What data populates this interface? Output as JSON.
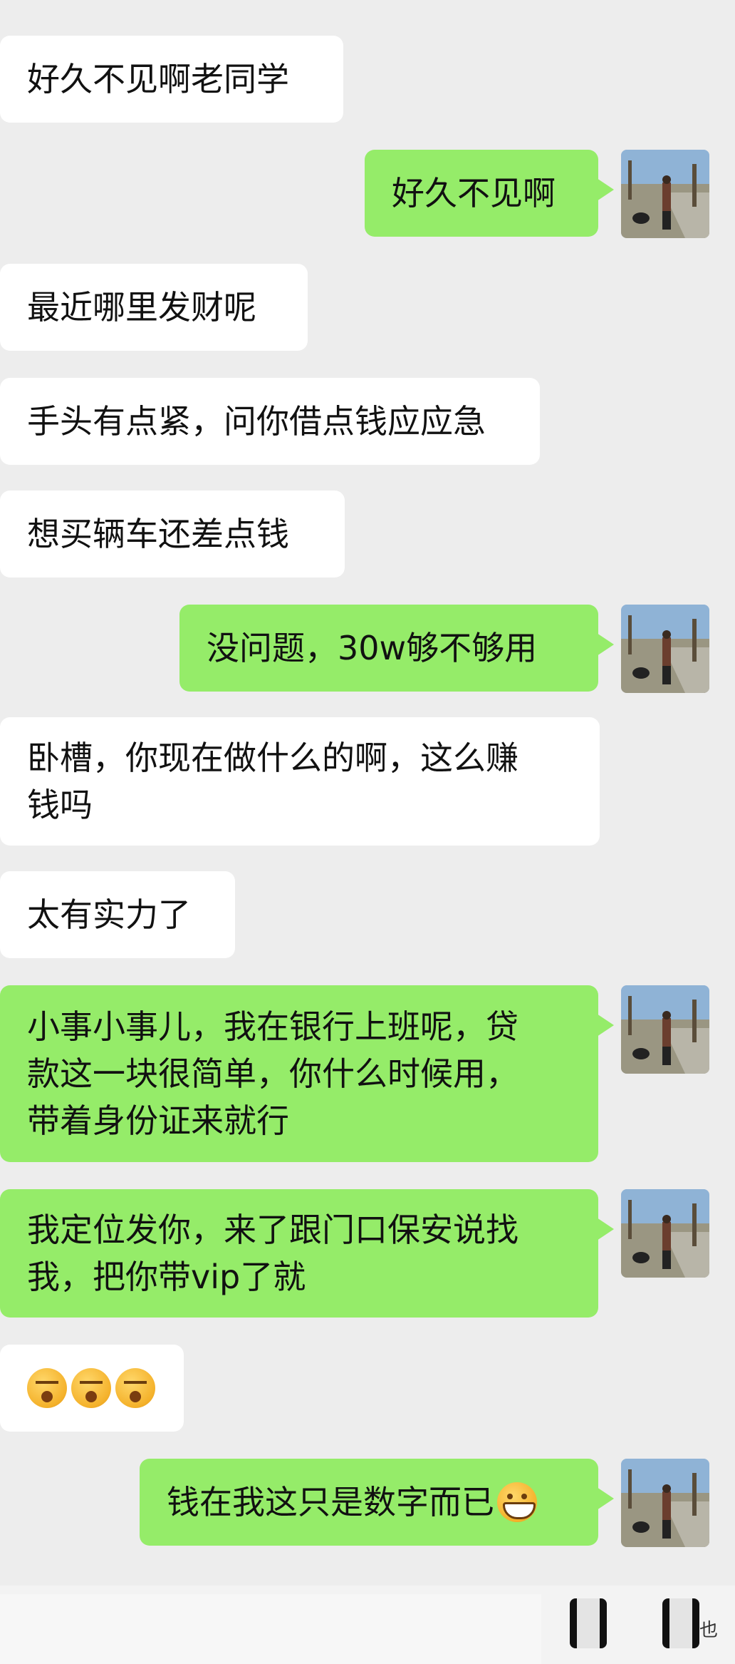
{
  "messages": [
    {
      "side": "left",
      "text": "好久不见啊老同学"
    },
    {
      "side": "right",
      "text": "好久不见啊"
    },
    {
      "side": "left",
      "text": "最近哪里发财呢"
    },
    {
      "side": "left",
      "text": "手头有点紧，问你借点钱应应急"
    },
    {
      "side": "left",
      "text": "想买辆车还差点钱"
    },
    {
      "side": "right",
      "text": "没问题，30w够不够用"
    },
    {
      "side": "left",
      "text": "卧槽，你现在做什么的啊，这么赚\n钱吗"
    },
    {
      "side": "left",
      "text": "太有实力了"
    },
    {
      "side": "right",
      "text": "小事小事儿，我在银行上班呢，贷\n款这一块很简单，你什么时候用，\n带着身份证来就行"
    },
    {
      "side": "right",
      "text": "我定位发你，来了跟门口保安说找\n我，把你带vip了就"
    },
    {
      "side": "left",
      "emoji": [
        "sleepy-face-icon",
        "sleepy-face-icon",
        "sleepy-face-icon"
      ]
    },
    {
      "side": "right",
      "text": "钱在我这只是数字而已",
      "emoji": "grin-face-icon"
    }
  ],
  "watermark": "也",
  "colors": {
    "right_bubble": "#95ec69",
    "left_bubble": "#ffffff",
    "background": "#ededed"
  }
}
